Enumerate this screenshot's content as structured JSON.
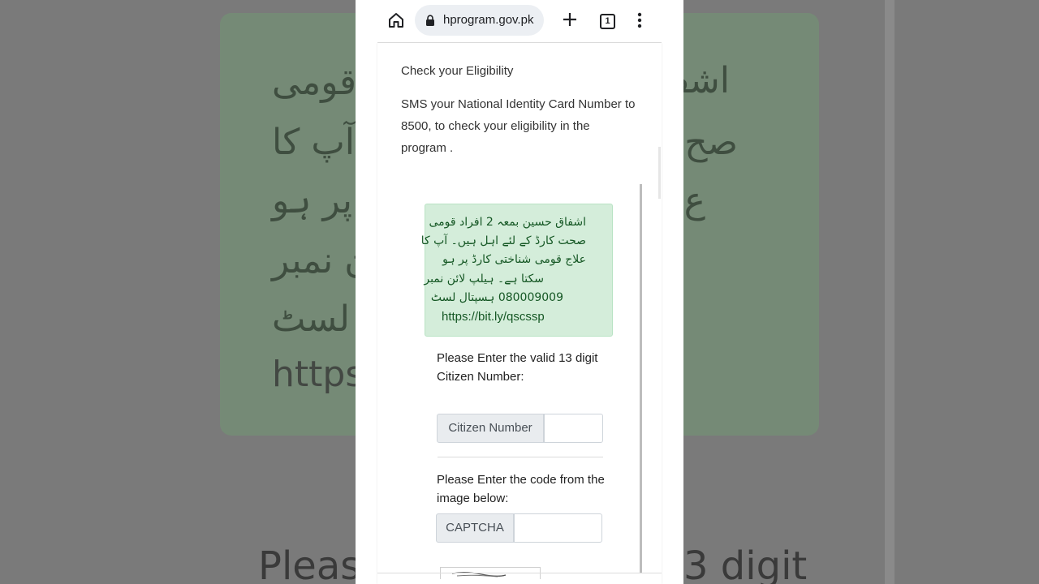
{
  "browser": {
    "url": "hprogram.gov.pk",
    "tab_count": "1"
  },
  "page": {
    "eligibility_title": "Check your Eligibility",
    "eligibility_description": "SMS your National Identity Card Number to 8500, to check your eligibility in the program .",
    "alert_lines": [
      "اشفاق حسین بمعہ 2 افراد قومی",
      "صحت کارڈ کے لئے اہل ہیں۔ آپ کا",
      "علاج قومی شناختی کارڈ پر ہو",
      "سکتا ہے۔ ہیلپ لائن نمبر",
      "080009009 ہسپتال لسٹ"
    ],
    "alert_url": "https://bit.ly/qscssp",
    "citizen_label": "Please Enter the valid 13 digit Citizen Number:",
    "citizen_addon": "Citizen Number",
    "citizen_value": "",
    "captcha_label": "Please Enter the code from the image below:",
    "captcha_addon": "CAPTCHA",
    "captcha_value": ""
  },
  "background": {
    "lines": [
      "اشف",
      "قومی",
      "صح",
      "آپ کا",
      "ع",
      "پر ہو",
      "ن نمبر",
      "ل لسٹ",
      "https"
    ],
    "bottom_text": "Pleas",
    "bottom_text_right": "3 digit"
  },
  "colors": {
    "alert_bg": "#d4edda",
    "alert_text": "#155724",
    "addon_bg": "#e9ecef"
  }
}
